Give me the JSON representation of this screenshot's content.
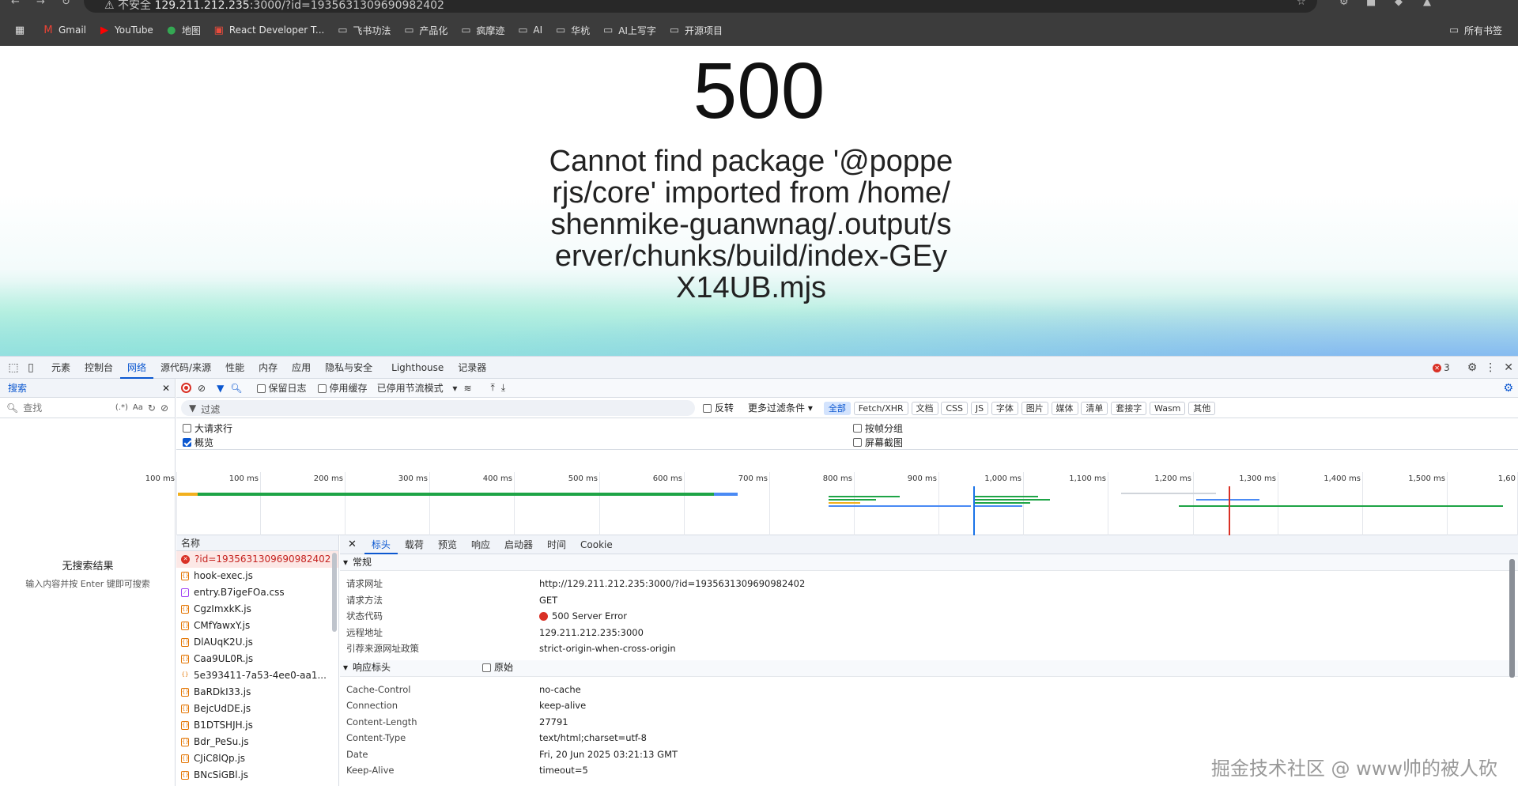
{
  "browser": {
    "address_prefix": "不安全",
    "address_host": "129.211.212.235",
    "address_rest": ":3000/?id=1935631309690982402",
    "bookmarks": [
      {
        "label": "Gmail",
        "icon": "gmail-icon"
      },
      {
        "label": "YouTube",
        "icon": "youtube-icon"
      },
      {
        "label": "地图",
        "icon": "maps-icon"
      },
      {
        "label": "React Developer T...",
        "icon": "react-icon"
      },
      {
        "label": "飞书功法",
        "icon": "folder-icon"
      },
      {
        "label": "产品化",
        "icon": "folder-icon"
      },
      {
        "label": "疯摩迹",
        "icon": "folder-icon"
      },
      {
        "label": "AI",
        "icon": "folder-icon"
      },
      {
        "label": "华杭",
        "icon": "folder-icon"
      },
      {
        "label": "AI上写字",
        "icon": "folder-icon"
      },
      {
        "label": "开源项目",
        "icon": "folder-icon"
      }
    ],
    "all_bookmarks": "所有书签"
  },
  "page": {
    "error_code": "500",
    "error_message": "Cannot find package '@popperjs/core' imported from /home/shenmike-guanwnag/.output/server/chunks/build/index-GEyX14UB.mjs"
  },
  "devtools": {
    "tabs": [
      "元素",
      "控制台",
      "网络",
      "源代码/来源",
      "性能",
      "内存",
      "应用",
      "隐私与安全",
      "Lighthouse",
      "记录器"
    ],
    "active_tab": "网络",
    "error_count": "3",
    "search": {
      "title": "搜索",
      "placeholder": "查找",
      "regex": "(.*)",
      "case": "Aa",
      "no_results": "无搜索结果",
      "hint": "输入内容并按 Enter 键即可搜索"
    },
    "toolbar": {
      "preserve_log": "保留日志",
      "disable_cache": "停用缓存",
      "throttling": "已停用节流模式"
    },
    "filter": {
      "placeholder": "过滤",
      "invert": "反转",
      "more_filters": "更多过滤条件",
      "types": [
        "全部",
        "Fetch/XHR",
        "文档",
        "CSS",
        "JS",
        "字体",
        "图片",
        "媒体",
        "清单",
        "套接字",
        "Wasm",
        "其他"
      ],
      "active_type": "全部"
    },
    "options": {
      "big_rows": "大请求行",
      "overview": "概览",
      "group_by_frame": "按帧分组",
      "screenshots": "屏幕截图"
    },
    "timeline_ticks": [
      "100 ms",
      "200 ms",
      "300 ms",
      "400 ms",
      "500 ms",
      "600 ms",
      "700 ms",
      "800 ms",
      "900 ms",
      "1,000 ms",
      "1,100 ms",
      "1,200 ms",
      "1,300 ms",
      "1,400 ms",
      "1,500 ms",
      "1,60"
    ],
    "requests_header": "名称",
    "requests": [
      {
        "name": "?id=1935631309690982402",
        "type": "err"
      },
      {
        "name": "hook-exec.js",
        "type": "js"
      },
      {
        "name": "entry.B7igeFOa.css",
        "type": "css"
      },
      {
        "name": "CgzImxkK.js",
        "type": "js"
      },
      {
        "name": "CMfYawxY.js",
        "type": "js"
      },
      {
        "name": "DlAUqK2U.js",
        "type": "js"
      },
      {
        "name": "Caa9UL0R.js",
        "type": "js"
      },
      {
        "name": "5e393411-7a53-4ee0-aa1...",
        "type": "js"
      },
      {
        "name": "BaRDkI33.js",
        "type": "js"
      },
      {
        "name": "BejcUdDE.js",
        "type": "js"
      },
      {
        "name": "B1DTSHJH.js",
        "type": "js"
      },
      {
        "name": "Bdr_PeSu.js",
        "type": "js"
      },
      {
        "name": "CJiC8lQp.js",
        "type": "js"
      },
      {
        "name": "BNcSiGBl.js",
        "type": "js"
      }
    ],
    "detail_tabs": [
      "标头",
      "载荷",
      "预览",
      "响应",
      "启动器",
      "时间",
      "Cookie"
    ],
    "detail_active": "标头",
    "general_title": "常规",
    "general": [
      {
        "k": "请求网址",
        "v": "http://129.211.212.235:3000/?id=1935631309690982402"
      },
      {
        "k": "请求方法",
        "v": "GET"
      },
      {
        "k": "状态代码",
        "v": "500 Server Error"
      },
      {
        "k": "远程地址",
        "v": "129.211.212.235:3000"
      },
      {
        "k": "引荐来源网址政策",
        "v": "strict-origin-when-cross-origin"
      }
    ],
    "resp_title": "响应标头",
    "raw_label": "原始",
    "response_headers": [
      {
        "k": "Cache-Control",
        "v": "no-cache"
      },
      {
        "k": "Connection",
        "v": "keep-alive"
      },
      {
        "k": "Content-Length",
        "v": "27791"
      },
      {
        "k": "Content-Type",
        "v": "text/html;charset=utf-8"
      },
      {
        "k": "Date",
        "v": "Fri, 20 Jun 2025 03:21:13 GMT"
      },
      {
        "k": "Keep-Alive",
        "v": "timeout=5"
      }
    ]
  },
  "watermark": "掘金技术社区 @ www帅的被人砍"
}
